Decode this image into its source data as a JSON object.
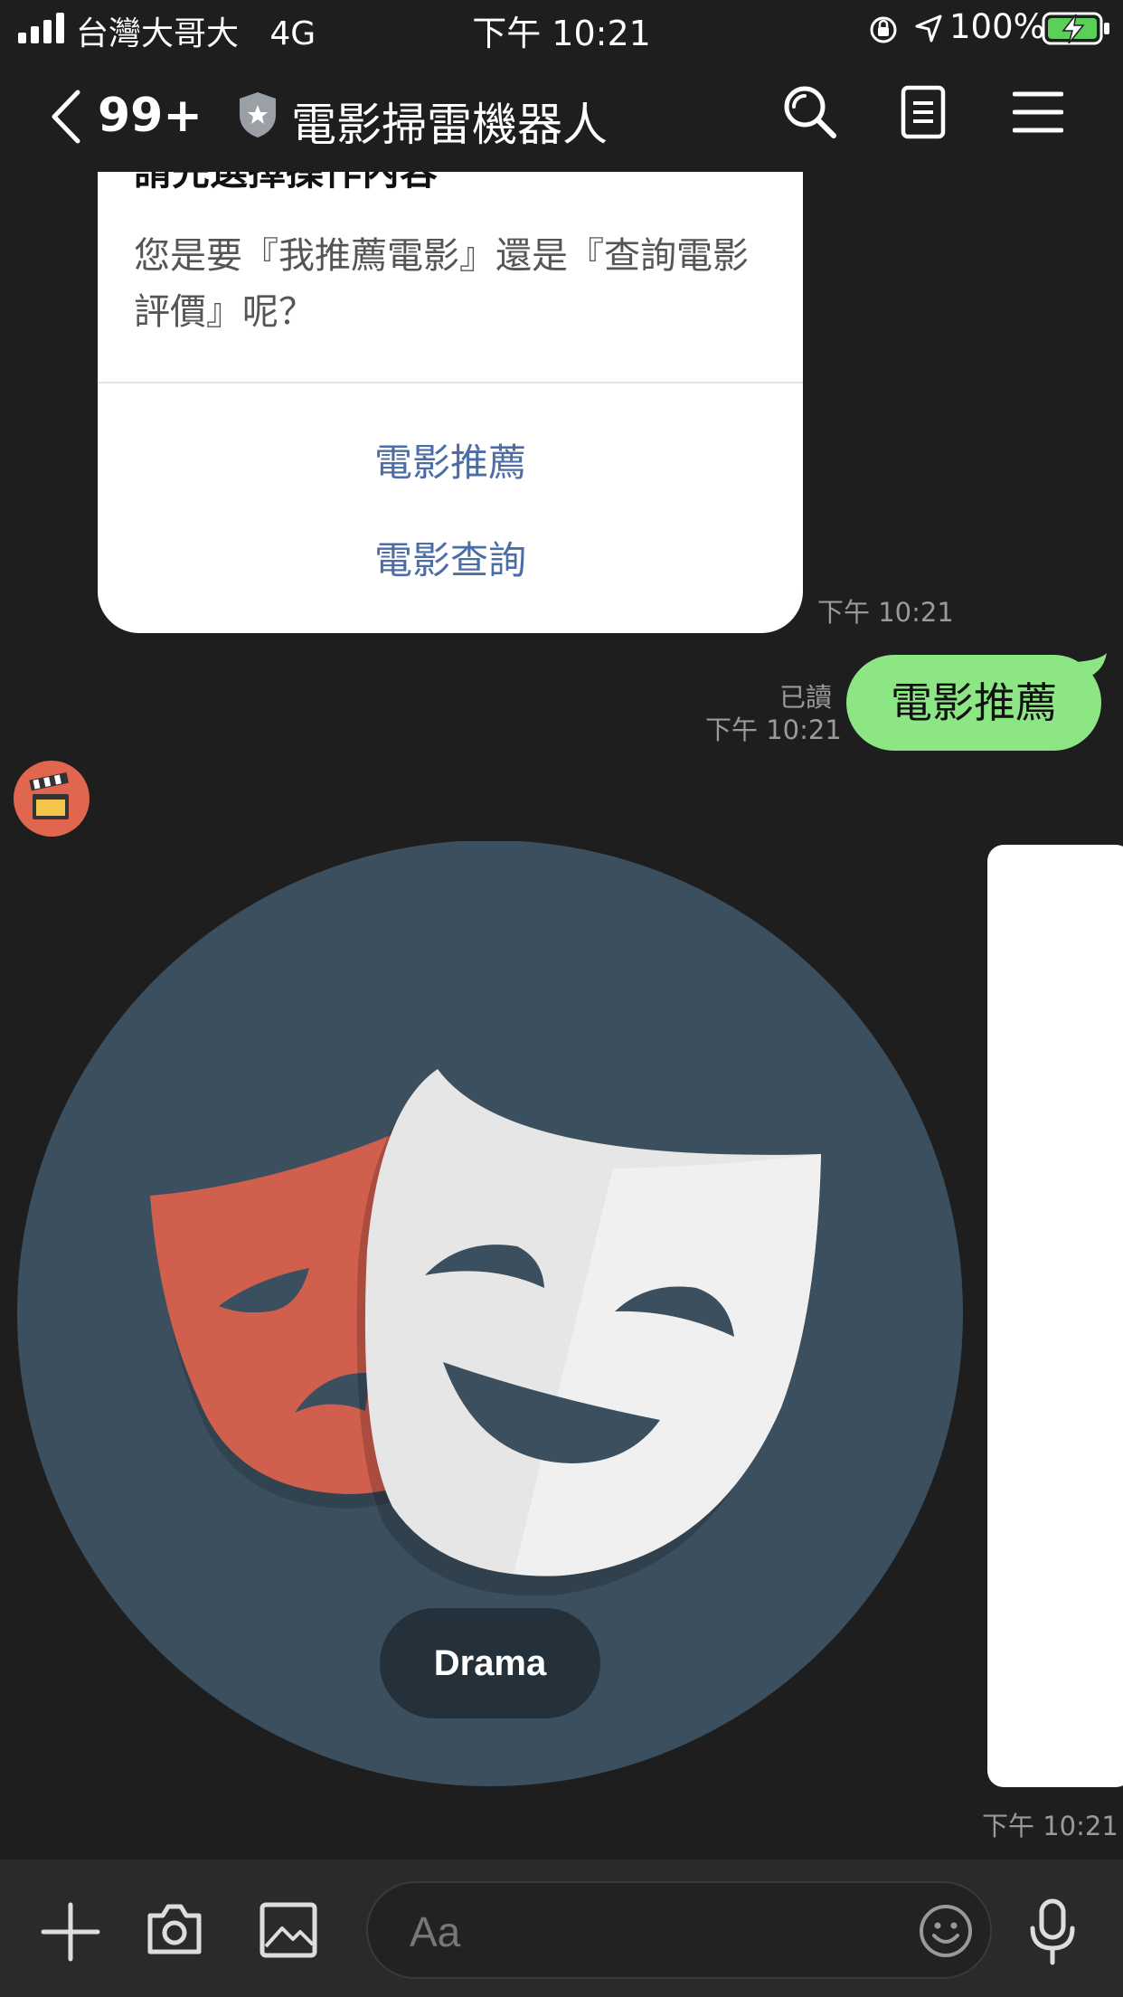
{
  "status_bar": {
    "carrier": "台灣大哥大",
    "network": "4G",
    "time": "下午 10:21",
    "battery": "100%"
  },
  "header": {
    "unread_count": "99+",
    "title": "電影掃雷機器人"
  },
  "prior_card": {
    "title": "請先選擇操作內容",
    "question": "您是要『我推薦電影』還是『查詢電影評價』呢？",
    "options": [
      "電影推薦",
      "電影查詢"
    ],
    "timestamp": "下午 10:21"
  },
  "sent_message": {
    "text": "電影推薦",
    "read_label": "已讀",
    "timestamp": "下午 10:21"
  },
  "bot_card": {
    "genre_label": "Drama",
    "timestamp": "下午 10:21",
    "icon": "theater-masks"
  },
  "input_bar": {
    "placeholder": "Aa"
  },
  "colors": {
    "background": "#1e1e1e",
    "sent_bubble": "#8ce684",
    "card_circle": "#3b4f5e",
    "link_blue": "#4c6ea4"
  }
}
